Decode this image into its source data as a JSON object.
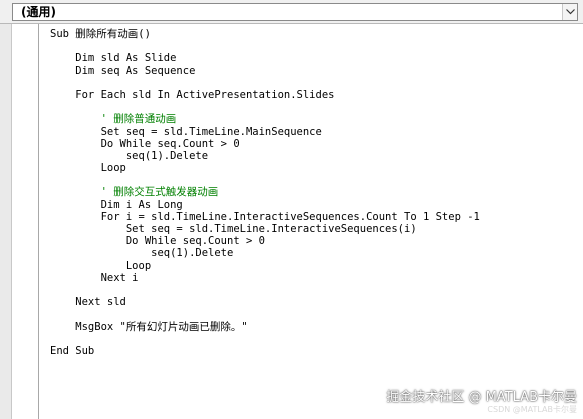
{
  "object_box": {
    "label": "(通用)",
    "dropdown_icon": "chevron-down-icon"
  },
  "code": {
    "lines": [
      {
        "text": "Sub 删除所有动画()",
        "kind": "code"
      },
      {
        "text": "",
        "kind": "code"
      },
      {
        "text": "    Dim sld As Slide",
        "kind": "code"
      },
      {
        "text": "    Dim seq As Sequence",
        "kind": "code"
      },
      {
        "text": "",
        "kind": "code"
      },
      {
        "text": "    For Each sld In ActivePresentation.Slides",
        "kind": "code"
      },
      {
        "text": "",
        "kind": "code"
      },
      {
        "text": "        ' 删除普通动画",
        "kind": "comment"
      },
      {
        "text": "        Set seq = sld.TimeLine.MainSequence",
        "kind": "code"
      },
      {
        "text": "        Do While seq.Count > 0",
        "kind": "code"
      },
      {
        "text": "            seq(1).Delete",
        "kind": "code"
      },
      {
        "text": "        Loop",
        "kind": "code"
      },
      {
        "text": "",
        "kind": "code"
      },
      {
        "text": "        ' 删除交互式触发器动画",
        "kind": "comment"
      },
      {
        "text": "        Dim i As Long",
        "kind": "code"
      },
      {
        "text": "        For i = sld.TimeLine.InteractiveSequences.Count To 1 Step -1",
        "kind": "code"
      },
      {
        "text": "            Set seq = sld.TimeLine.InteractiveSequences(i)",
        "kind": "code"
      },
      {
        "text": "            Do While seq.Count > 0",
        "kind": "code"
      },
      {
        "text": "                seq(1).Delete",
        "kind": "code"
      },
      {
        "text": "            Loop",
        "kind": "code"
      },
      {
        "text": "        Next i",
        "kind": "code"
      },
      {
        "text": "",
        "kind": "code"
      },
      {
        "text": "    Next sld",
        "kind": "code"
      },
      {
        "text": "",
        "kind": "code"
      },
      {
        "text": "    MsgBox \"所有幻灯片动画已删除。\"",
        "kind": "code"
      },
      {
        "text": "",
        "kind": "code"
      },
      {
        "text": "End Sub",
        "kind": "code"
      }
    ]
  },
  "watermark": {
    "main": "掘金技术社区 @ MATLAB卡尔曼",
    "sub": "CSDN @MATLAB卡尔曼"
  }
}
